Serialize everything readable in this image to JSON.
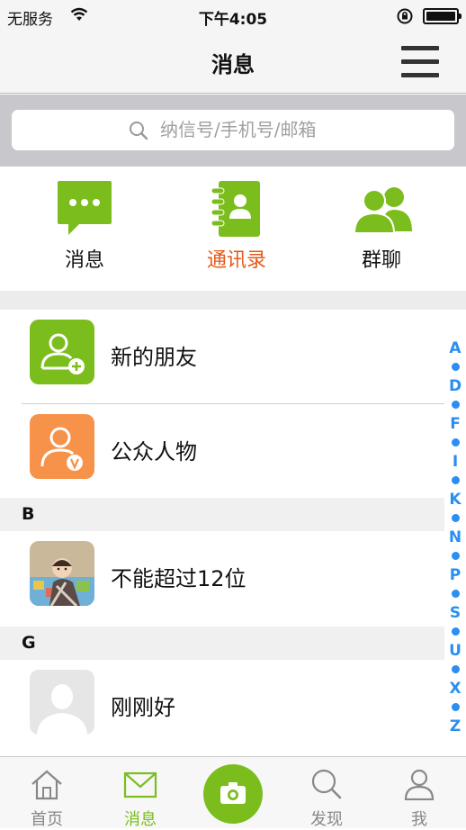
{
  "status_bar": {
    "carrier": "无服务",
    "time": "下午4:05"
  },
  "nav": {
    "title": "消息"
  },
  "search": {
    "placeholder": "纳信号/手机号/邮箱"
  },
  "quick_tabs": [
    {
      "label": "消息",
      "icon": "chat-bubble-icon",
      "color": "#111111"
    },
    {
      "label": "通讯录",
      "icon": "address-book-icon",
      "color": "#e55a1b",
      "active": true
    },
    {
      "label": "群聊",
      "icon": "group-icon",
      "color": "#111111"
    }
  ],
  "contacts": {
    "top": [
      {
        "name": "新的朋友",
        "icon": "add-friend-icon",
        "color": "#7cbd1e"
      },
      {
        "name": "公众人物",
        "icon": "public-figure-icon",
        "color": "#f7924a"
      }
    ],
    "sections": [
      {
        "letter": "B",
        "items": [
          {
            "name": "不能超过12位",
            "avatar": "baby-photo"
          }
        ]
      },
      {
        "letter": "G",
        "items": [
          {
            "name": "刚刚好",
            "avatar": "default-avatar"
          }
        ]
      }
    ]
  },
  "index_letters": [
    "A",
    "D",
    "F",
    "I",
    "K",
    "N",
    "P",
    "S",
    "U",
    "X",
    "Z"
  ],
  "tab_bar": [
    {
      "label": "首页",
      "icon": "home-icon"
    },
    {
      "label": "消息",
      "icon": "mail-icon",
      "active": true
    },
    {
      "label": "",
      "icon": "camera-icon"
    },
    {
      "label": "发现",
      "icon": "search-icon"
    },
    {
      "label": "我",
      "icon": "person-icon"
    }
  ],
  "colors": {
    "accent_green": "#7cbd1e",
    "active_orange": "#e55a1b",
    "index_blue": "#2a8ef2",
    "orange_badge": "#f7924a"
  }
}
